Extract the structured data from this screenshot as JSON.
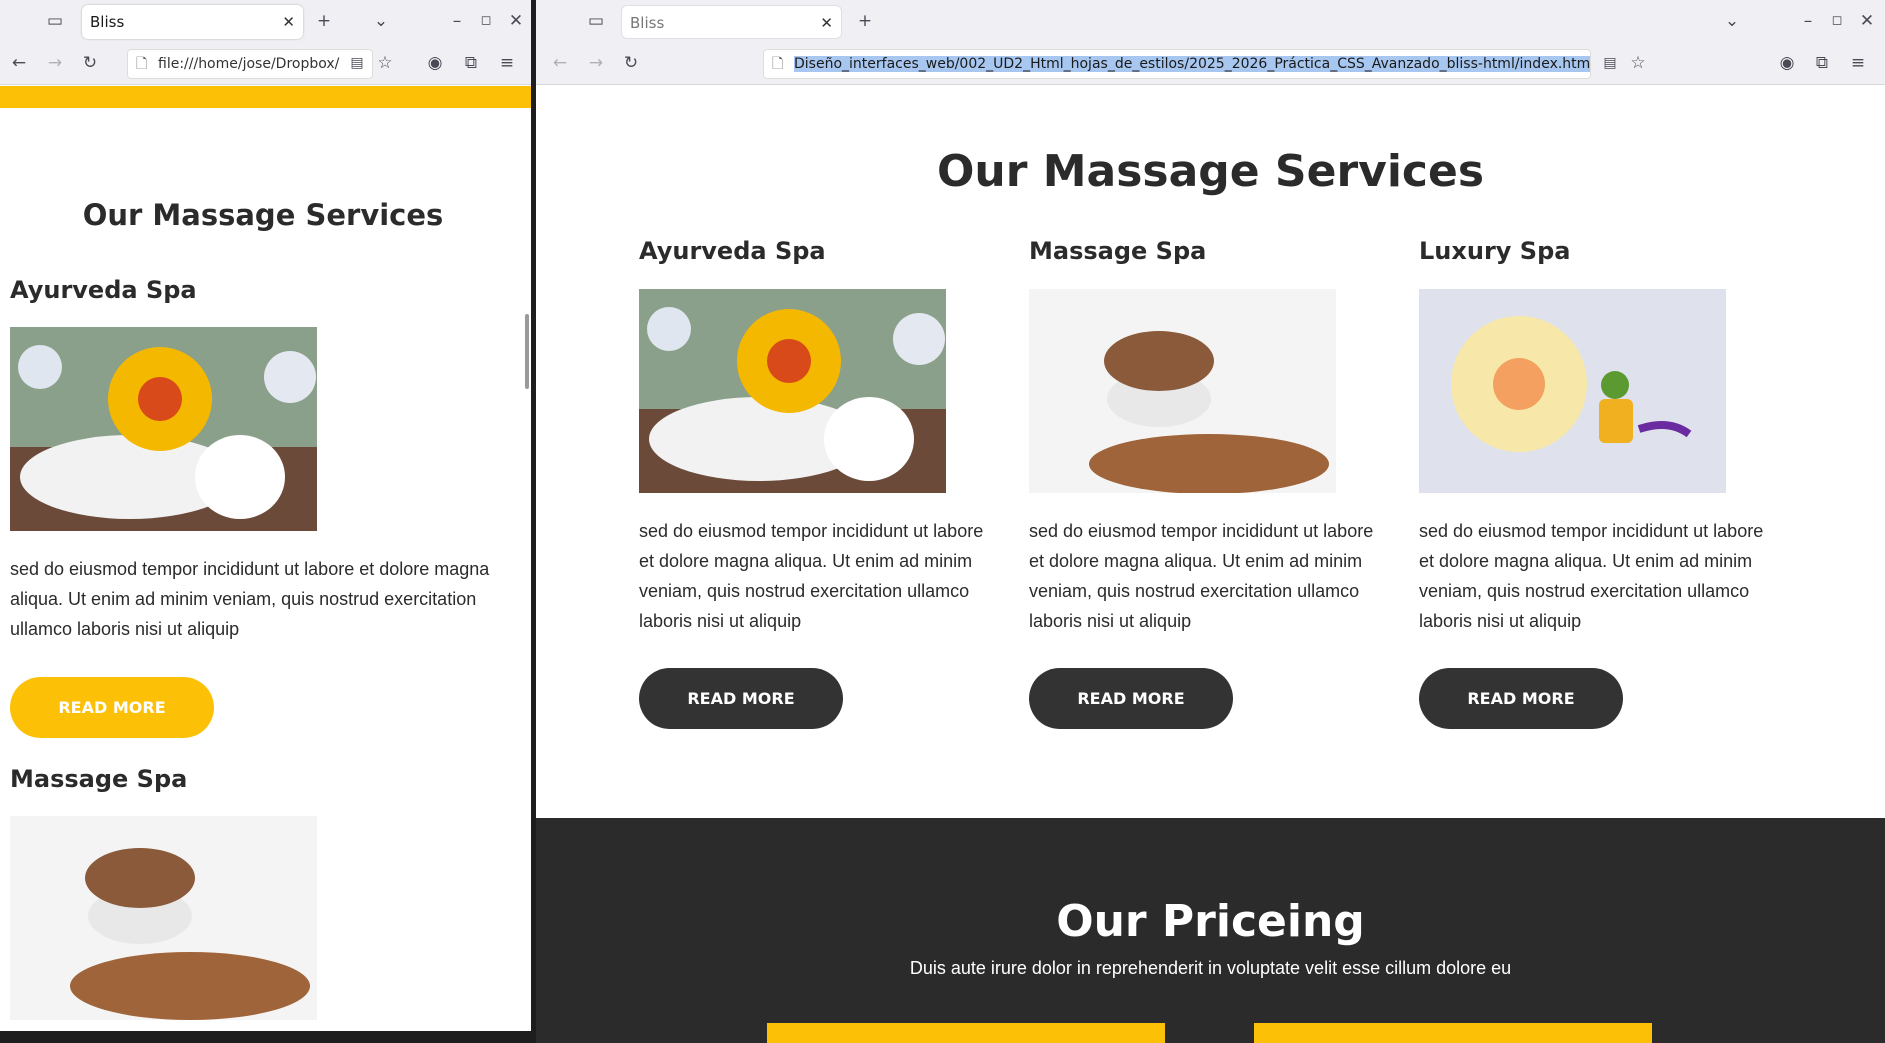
{
  "left_window": {
    "tab_title": "Bliss",
    "url": "file:///home/jose/Dropbox/",
    "heading": "Our Massage Services",
    "services": [
      {
        "title": "Ayurveda Spa",
        "text": "sed do eiusmod tempor incididunt ut labore et dolore magna aliqua. Ut enim ad minim veniam, quis nostrud exercitation ullamco laboris nisi ut aliquip",
        "button": "READ MORE"
      },
      {
        "title": "Massage Spa"
      }
    ]
  },
  "right_window": {
    "tab_title": "Bliss",
    "url": "Diseño_interfaces_web/002_UD2_Html_hojas_de_estilos/2025_2026_Práctica_CSS_Avanzado_bliss-html/index.html",
    "heading": "Our Massage Services",
    "services": [
      {
        "title": "Ayurveda Spa",
        "text": "sed do eiusmod tempor incididunt ut labore et dolore magna aliqua. Ut enim ad minim veniam, quis nostrud exercitation ullamco laboris nisi ut aliquip",
        "button": "READ MORE"
      },
      {
        "title": "Massage Spa",
        "text": "sed do eiusmod tempor incididunt ut labore et dolore magna aliqua. Ut enim ad minim veniam, quis nostrud exercitation ullamco laboris nisi ut aliquip",
        "button": "READ MORE"
      },
      {
        "title": "Luxury Spa",
        "text": "sed do eiusmod tempor incididunt ut labore et dolore magna aliqua. Ut enim ad minim veniam, quis nostrud exercitation ullamco laboris nisi ut aliquip",
        "button": "READ MORE"
      }
    ],
    "pricing_heading": "Our Priceing",
    "pricing_subtitle": "Duis aute irure dolor in reprehenderit in voluptate velit esse cillum dolore eu"
  },
  "icons": {
    "tab_overview": "tab-overview-icon",
    "new_tab": "plus-icon",
    "tab_list": "chevron-down-icon",
    "back": "arrow-left-icon",
    "forward": "arrow-right-icon",
    "reload": "reload-icon",
    "page": "document-icon",
    "reader": "reader-view-icon",
    "bookmark": "star-icon",
    "account": "account-icon",
    "extensions": "puzzle-icon",
    "menu": "hamburger-icon",
    "minimize": "minimize-icon",
    "maximize": "maximize-icon",
    "close": "close-icon"
  },
  "colors": {
    "accent": "#fcc106",
    "dark_section": "#2b2b2b",
    "button_dark": "#333333",
    "text": "#2b2b2b"
  }
}
